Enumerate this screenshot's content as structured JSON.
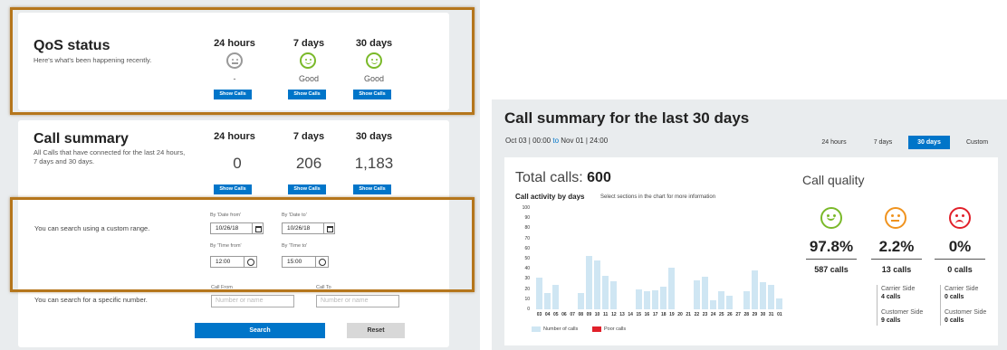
{
  "qos": {
    "title": "QoS status",
    "subtitle": "Here's what's been happening recently.",
    "columns": [
      {
        "period": "24 hours",
        "status": "-",
        "mood": "neutral",
        "button": "Show Calls"
      },
      {
        "period": "7 days",
        "status": "Good",
        "mood": "good",
        "button": "Show Calls"
      },
      {
        "period": "30 days",
        "status": "Good",
        "mood": "good",
        "button": "Show Calls"
      }
    ]
  },
  "summary": {
    "title": "Call summary",
    "subtitle_line1": "All Calls that have connected for the last 24 hours,",
    "subtitle_line2": "7 days and 30 days.",
    "columns": [
      {
        "period": "24 hours",
        "count": "0",
        "button": "Show Calls"
      },
      {
        "period": "7 days",
        "count": "206",
        "button": "Show Calls"
      },
      {
        "period": "30 days",
        "count": "1,183",
        "button": "Show Calls"
      }
    ]
  },
  "search": {
    "custom_range_text": "You can search using a custom range.",
    "date_from_label": "By 'Date from'",
    "date_from_value": "10/26/18",
    "date_to_label": "By 'Date to'",
    "date_to_value": "10/26/18",
    "time_from_label": "By 'Time from'",
    "time_from_value": "12:00",
    "time_to_label": "By 'Time to'",
    "time_to_value": "15:00",
    "specific_number_text": "You can search for a specific number.",
    "call_from_label": "Call From",
    "call_from_placeholder": "Number or name",
    "call_to_label": "Call To",
    "call_to_placeholder": "Number or name",
    "search_button": "Search",
    "reset_button": "Reset"
  },
  "detail": {
    "title": "Call summary for the last 30 days",
    "range_start": "Oct 03  |  00:00",
    "range_to": "to",
    "range_end": "Nov 01  |  24:00",
    "tabs": [
      {
        "label": "24 hours",
        "active": false
      },
      {
        "label": "7 days",
        "active": false
      },
      {
        "label": "30 days",
        "active": true
      },
      {
        "label": "Custom",
        "active": false
      }
    ],
    "total_label": "Total calls:",
    "total_value": "600",
    "activity_label": "Call activity by days",
    "activity_hint": "Select sections in the chart for more information",
    "legend_calls": "Number of calls",
    "legend_poor": "Poor calls",
    "colors": {
      "calls": "#cfe6f3",
      "poor": "#e1202a",
      "accent": "#0075c9",
      "good": "#7ab929",
      "neutral": "#f0931e",
      "bad": "#e1202a"
    },
    "quality_label": "Call quality",
    "quality": [
      {
        "mood": "good",
        "pct": "97.8%",
        "calls": "587 calls"
      },
      {
        "mood": "neutral",
        "pct": "2.2%",
        "calls": "13 calls"
      },
      {
        "mood": "bad",
        "pct": "0%",
        "calls": "0 calls"
      }
    ],
    "breakdown": [
      {
        "carrier_label": "Carrier Side",
        "carrier_value": "4 calls",
        "customer_label": "Customer Side",
        "customer_value": "9 calls"
      },
      {
        "carrier_label": "Carrier Side",
        "carrier_value": "0 calls",
        "customer_label": "Customer Side",
        "customer_value": "0 calls"
      }
    ]
  },
  "chart_data": {
    "type": "bar",
    "title": "Call activity by days",
    "categories": [
      "03",
      "04",
      "05",
      "06",
      "07",
      "08",
      "09",
      "10",
      "11",
      "12",
      "13",
      "14",
      "15",
      "16",
      "17",
      "18",
      "19",
      "20",
      "21",
      "22",
      "23",
      "24",
      "25",
      "26",
      "27",
      "28",
      "29",
      "30",
      "31",
      "01"
    ],
    "values": [
      31,
      16,
      24,
      0,
      0,
      16,
      53,
      48,
      33,
      28,
      0,
      0,
      20,
      18,
      19,
      22,
      41,
      0,
      0,
      29,
      32,
      9,
      18,
      13,
      0,
      18,
      38,
      27,
      24,
      11
    ],
    "series": [
      {
        "name": "Number of calls",
        "values": [
          31,
          16,
          24,
          0,
          0,
          16,
          53,
          48,
          33,
          28,
          0,
          0,
          20,
          18,
          19,
          22,
          41,
          0,
          0,
          29,
          32,
          9,
          18,
          13,
          0,
          18,
          38,
          27,
          24,
          11
        ]
      },
      {
        "name": "Poor calls",
        "values": [
          0,
          0,
          0,
          0,
          0,
          0,
          0,
          0,
          0,
          0,
          0,
          0,
          0,
          0,
          0,
          0,
          0,
          0,
          0,
          0,
          0,
          0,
          0,
          0,
          0,
          0,
          0,
          0,
          0,
          0
        ]
      }
    ],
    "yticks": [
      "100",
      "90",
      "80",
      "70",
      "60",
      "50",
      "40",
      "30",
      "20",
      "10",
      "0"
    ],
    "ylim": [
      0,
      100
    ],
    "legend": "bottom-left"
  }
}
